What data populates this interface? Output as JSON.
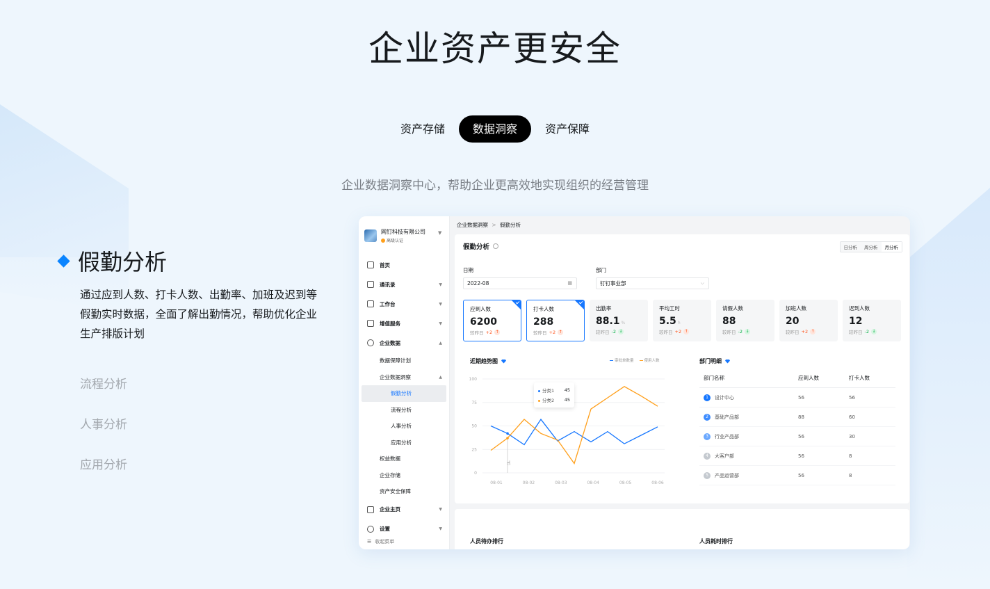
{
  "hero": {
    "title": "企业资产更安全",
    "subtitle": "企业数据洞察中心，帮助企业更高效地实现组织的经营管理"
  },
  "tabs": [
    {
      "label": "资产存储"
    },
    {
      "label": "数据洞察",
      "active": true
    },
    {
      "label": "资产保障"
    }
  ],
  "features": {
    "active_title": "假勤分析",
    "active_desc": "通过应到人数、打卡人数、出勤率、加班及迟到等假勤实时数据，全面了解出勤情况，帮助优化企业生产排版计划",
    "others": [
      "流程分析",
      "人事分析",
      "应用分析"
    ]
  },
  "app": {
    "org": {
      "name": "网钉科技有限公司",
      "badge": "高级认证"
    },
    "nav": [
      {
        "label": "首页",
        "icon": "home-icon"
      },
      {
        "label": "通讯录",
        "icon": "contacts-icon",
        "caret": "▼"
      },
      {
        "label": "工作台",
        "icon": "grid-icon",
        "caret": "▼"
      },
      {
        "label": "增值服务",
        "icon": "trend-icon",
        "caret": "▼"
      },
      {
        "label": "企业数据",
        "icon": "data-icon",
        "caret": "▲"
      }
    ],
    "nav_sub": [
      "数据保障计划",
      "企业数据洞察"
    ],
    "nav_sub_caret": "▲",
    "nav_sub2": [
      {
        "label": "假勤分析",
        "active": true
      },
      {
        "label": "流程分析"
      },
      {
        "label": "人事分析"
      },
      {
        "label": "应用分析"
      }
    ],
    "nav_sub_more": [
      "权益数据",
      "企业存储",
      "资产安全保障"
    ],
    "nav_bottom": [
      {
        "label": "企业主页",
        "icon": "building-icon",
        "caret": "▼"
      },
      {
        "label": "设置",
        "icon": "settings-icon",
        "caret": "▼"
      }
    ],
    "collapse_label": "收起菜单",
    "breadcrumb": {
      "parent": "企业数据洞察",
      "sep": ">",
      "current": "假勤分析"
    },
    "page_title": "假勤分析",
    "segments": [
      {
        "label": "日分析"
      },
      {
        "label": "周分析"
      },
      {
        "label": "月分析",
        "active": true
      }
    ],
    "filters": {
      "date_label": "日期",
      "date_value": "2022-08",
      "dept_label": "部门",
      "dept_value": "钉钉事业部"
    },
    "kpis": [
      {
        "label": "应到人数",
        "value": "6200",
        "unit": "",
        "cmp": "较昨日",
        "delta": "+2",
        "dir": "up",
        "selected": true
      },
      {
        "label": "打卡人数",
        "value": "288",
        "unit": "",
        "cmp": "较昨日",
        "delta": "+2",
        "dir": "up",
        "selected": true
      },
      {
        "label": "出勤率",
        "value": "88.1",
        "unit": "%",
        "cmp": "较昨日",
        "delta": "-2",
        "dir": "down"
      },
      {
        "label": "平均工时",
        "value": "5.5",
        "unit": "h",
        "cmp": "较昨日",
        "delta": "+2",
        "dir": "up"
      },
      {
        "label": "请假人数",
        "value": "88",
        "unit": "",
        "cmp": "较昨日",
        "delta": "-2",
        "dir": "down"
      },
      {
        "label": "加班人数",
        "value": "20",
        "unit": "",
        "cmp": "较昨日",
        "delta": "+2",
        "dir": "up"
      },
      {
        "label": "迟到人数",
        "value": "12",
        "unit": "",
        "cmp": "较昨日",
        "delta": "-2",
        "dir": "down"
      }
    ],
    "trend": {
      "title": "近期趋势图",
      "legend": [
        "审批单数量",
        "使用人数"
      ],
      "tooltip": [
        {
          "name": "分类1",
          "value": "45"
        },
        {
          "name": "分类2",
          "value": "45"
        }
      ]
    },
    "dept": {
      "title": "部门明细",
      "headers": [
        "部门名称",
        "应到人数",
        "打卡人数"
      ],
      "rows": [
        {
          "rank": "1",
          "name": "设计中心",
          "expected": "56",
          "checked": "56"
        },
        {
          "rank": "2",
          "name": "基础产品部",
          "expected": "88",
          "checked": "60"
        },
        {
          "rank": "3",
          "name": "行业产品部",
          "expected": "56",
          "checked": "30"
        },
        {
          "rank": "4",
          "name": "大客户部",
          "expected": "56",
          "checked": "8"
        },
        {
          "rank": "5",
          "name": "产品运营部",
          "expected": "56",
          "checked": "8"
        }
      ]
    },
    "bottom": {
      "left_title": "人员待办排行",
      "right_title": "人员耗时排行"
    }
  },
  "colors": {
    "accent": "#1677ff",
    "series_blue": "#1677ff",
    "series_orange": "#ff9f1a",
    "up": "#ff5219",
    "down": "#00b042"
  },
  "chart_data": {
    "type": "line",
    "categories": [
      "08-01",
      "08-02",
      "08-03",
      "08-04",
      "08-05",
      "08-06"
    ],
    "x": [
      1,
      2,
      3,
      4,
      5,
      6,
      7,
      8,
      9,
      10,
      11
    ],
    "yticks": [
      "100",
      "75",
      "50",
      "25",
      "0"
    ],
    "ylim": [
      0,
      100
    ],
    "series": [
      {
        "name": "审批单数量",
        "values": [
          50,
          42,
          30,
          57,
          34,
          44,
          33,
          44,
          31,
          40,
          49
        ]
      },
      {
        "name": "使用人数",
        "values": [
          24,
          37,
          57,
          42,
          35,
          10,
          68,
          80,
          92,
          82,
          71
        ]
      }
    ],
    "grid": true,
    "legend": "top-right"
  }
}
